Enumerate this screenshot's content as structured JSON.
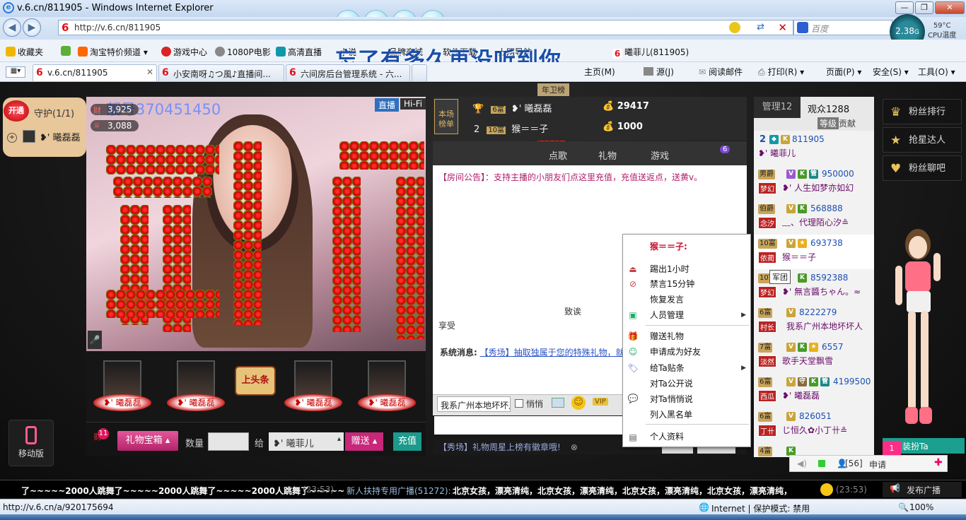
{
  "browser": {
    "window_title": "v.6.cn/811905 - Windows Internet Explorer",
    "address": "http://v.6.cn/811905",
    "search_placeholder": "百度",
    "cpu_usage": "2.38",
    "cpu_unit": "G",
    "cpu_temp": "59°C",
    "cpu_label": "CPU温度",
    "favorites": [
      "收藏夹",
      "淘宝特价频道",
      "游戏中心",
      "1080P电影",
      "高清直播",
      "小说",
      "品牌商城",
      "软件下载",
      "上网导航",
      "曦菲儿(811905)"
    ],
    "tabs": [
      {
        "label": "v.6.cn/811905",
        "active": true
      },
      {
        "label": "小安南呀♫つ風♪直播间...",
        "active": false
      },
      {
        "label": "六间房后台管理系统 - 六...",
        "active": false
      }
    ],
    "commands": [
      "主页(M)",
      "源(J)",
      "阅读邮件",
      "打印(R)",
      "页面(P)",
      "安全(S)",
      "工具(O)"
    ],
    "status_url": "http://v.6.cn/a/920175694",
    "status_zone": "Internet | 保护模式: 禁用",
    "zoom": "100%"
  },
  "lyric_overlay": "忘了有多久再没听到你",
  "left_panel": {
    "open_badge": "开通",
    "guard_label": "守护(1/1)",
    "guard_user": "❥' 曦磊磊",
    "mobile_label": "移动版"
  },
  "video": {
    "room_number": "靓号370451450",
    "live_label": "直播",
    "hifi_label": "Hi-Fi",
    "wealth_count": "3,925",
    "star_count": "3,088",
    "rose_text": "爱情棘"
  },
  "fans": {
    "names": [
      "❥' 曦磊磊",
      "❥' 曦磊磊",
      "❥' 曦磊磊",
      "❥' 曦磊磊"
    ],
    "headline_badge": "上头条"
  },
  "gift_bar": {
    "wealth_badge": "11",
    "gift_box_label": "礼物宝箱",
    "quantity_label": "数量",
    "to_label": "给",
    "recipient": "❥' 曦菲儿",
    "send_label": "赠送",
    "recharge_label": "充值"
  },
  "ranking": {
    "board_label": "本场榜单",
    "event_tag": "年卫榜",
    "rows": [
      {
        "rank": "1",
        "level": "6富",
        "name": "❥' 曦磊磊",
        "coins": "29417"
      },
      {
        "rank": "2",
        "level": "10富",
        "name": "猴＝＝子",
        "coins": "1000"
      }
    ]
  },
  "chat": {
    "tabs": [
      "点歌",
      "礼物",
      "游戏"
    ],
    "tab_badge": "6",
    "system_message": "【房间公告】：支持主播的小朋友们点这里充值，充值送返点，送黄v。",
    "system_message_2": "享受",
    "system_prefix": "系统消息:",
    "system_link": "【秀场】抽取独属于您的特殊礼物，就",
    "recipient_select": "我系广州本地坏坏人",
    "whisper_label": "悄悄",
    "vip_badge": "VIP",
    "toss_label": "致诶",
    "marquee": "【秀场】礼物周星上榜有徽章哦!"
  },
  "context_menu": {
    "header": "猴＝＝子:",
    "items": [
      {
        "label": "踢出1小时",
        "icon": "kick-icon",
        "submenu": false
      },
      {
        "label": "禁言15分钟",
        "icon": "mute-icon",
        "submenu": false
      },
      {
        "label": "恢复发言",
        "icon": "",
        "submenu": false
      },
      {
        "label": "人员管理",
        "icon": "manage-icon",
        "submenu": true
      },
      {
        "label": "赠送礼物",
        "icon": "gift-icon",
        "submenu": false
      },
      {
        "label": "申请成为好友",
        "icon": "add-friend-icon",
        "submenu": false
      },
      {
        "label": "给Ta贴条",
        "icon": "tag-icon",
        "submenu": true
      },
      {
        "label": "对Ta公开说",
        "icon": "",
        "submenu": false
      },
      {
        "label": "对Ta悄悄说",
        "icon": "whisper-icon",
        "submenu": false
      },
      {
        "label": "列入黑名单",
        "icon": "",
        "submenu": false
      },
      {
        "label": "个人资料",
        "icon": "profile-icon",
        "submenu": false
      }
    ]
  },
  "audience": {
    "manager_tab": "管理12",
    "viewers_tab": "观众1288",
    "level_sort": "等级",
    "contribution_sort": "贡献",
    "tooltip": "军团",
    "members": [
      {
        "level": "2",
        "id": "811905",
        "nick": "❥' 曦菲儿",
        "tag": ""
      },
      {
        "level": "男爵",
        "id": "950000",
        "nick": "❥' 人生如梦亦如幻",
        "tag": "梦幻"
      },
      {
        "level": "伯爵",
        "id": "568888",
        "nick": "﹏、代理陌心汐≗",
        "tag": "念汐"
      },
      {
        "level": "10富",
        "id": "693738",
        "nick": "猴＝＝子",
        "tag": "依蔺"
      },
      {
        "level": "10富",
        "id": "8592388",
        "nick": "❥' 無言醬ちゃん。≈",
        "tag": "梦幻"
      },
      {
        "level": "6富",
        "id": "8222279",
        "nick": "我系广州本地坏坏人",
        "tag": "村长"
      },
      {
        "level": "7富",
        "id": "6557",
        "nick": "歌手天堂飘雪",
        "tag": "淡然"
      },
      {
        "level": "6富",
        "id": "4199500",
        "nick": "❥' 曦磊磊",
        "tag": "西瓜"
      },
      {
        "level": "6富",
        "id": "826051",
        "nick": "じ恒久✿小丁卄≗",
        "tag": "丁卄"
      },
      {
        "level": "4富",
        "id": "",
        "nick": "",
        "tag": ""
      }
    ]
  },
  "right_sidebar": {
    "buttons": [
      "粉丝排行",
      "抢星达人",
      "粉丝聊吧"
    ],
    "dress_label": "装扮Ta",
    "dress_badge": "1",
    "online_count": "[56]",
    "apply_label": "申请"
  },
  "broadcast": {
    "left_msg": "了~~~~~2000人跳舞了~~~~~2000人跳舞了~~~~~2000人跳舞了~~~~~",
    "left_time": "(23:53)",
    "right_prefix": "新人扶持专用广播(51272):",
    "right_msg": "北京女孩，漂亮清纯，北京女孩，漂亮清纯，北京女孩，漂亮清纯，北京女孩，漂亮清纯，",
    "right_time": "(23:53)",
    "publish_label": "发布广播"
  }
}
